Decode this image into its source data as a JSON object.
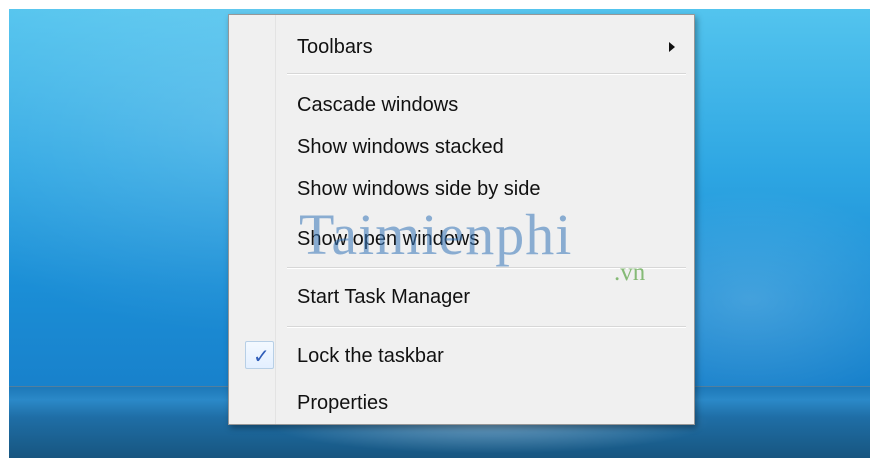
{
  "context_menu": {
    "items": [
      {
        "label": "Toolbars",
        "has_submenu": true
      },
      {
        "label": "Cascade windows"
      },
      {
        "label": "Show windows stacked"
      },
      {
        "label": "Show windows side by side"
      },
      {
        "label": "Show open windows"
      },
      {
        "label": "Start Task Manager"
      },
      {
        "label": "Lock the taskbar",
        "checked": true
      },
      {
        "label": "Properties"
      }
    ]
  },
  "icons": {
    "submenu_arrow": "chevron-right-icon",
    "checkmark": "checkmark-icon"
  },
  "watermark": {
    "main": "Taimienphi",
    "sub": ".vn"
  },
  "colors": {
    "desktop_blue": "#2fa7e3",
    "menu_background": "#f0f0f0",
    "menu_border": "#979797",
    "check_color": "#2f5db8",
    "watermark_blue": "#3474b8",
    "watermark_green": "#61a84e"
  }
}
